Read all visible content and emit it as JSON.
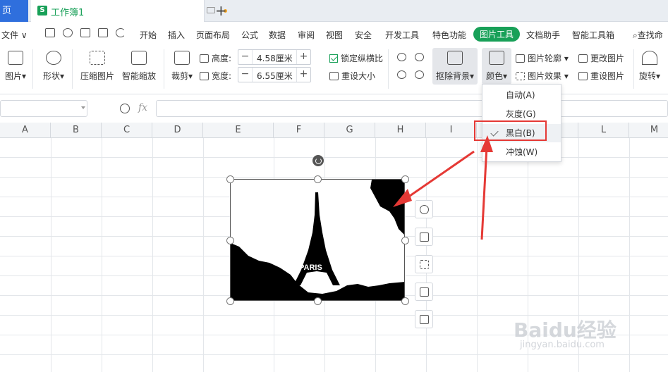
{
  "tabs": {
    "home": "页",
    "doc_title": "工作簿1",
    "doc_icon": "S"
  },
  "menu": {
    "file": "文件",
    "items": [
      "开始",
      "插入",
      "页面布局",
      "公式",
      "数据",
      "审阅",
      "视图",
      "安全",
      "开发工具",
      "特色功能",
      "图片工具",
      "文档助手",
      "智能工具箱"
    ],
    "active": "图片工具",
    "search": "查找命"
  },
  "ribbon": {
    "add_picture": "图片",
    "shape": "形状",
    "compress": "压缩图片",
    "smart_zoom": "智能缩放",
    "crop": "裁剪",
    "height_label": "高度:",
    "height_value": "4.58厘米",
    "width_label": "宽度:",
    "width_value": "6.55厘米",
    "lock_ratio": "锁定纵横比",
    "reset_size": "重设大小",
    "remove_bg": "抠除背景",
    "color": "颜色",
    "outline": "图片轮廓",
    "effect": "图片效果",
    "change": "更改图片",
    "reset_pic": "重设图片",
    "rotate": "旋转"
  },
  "formula": {
    "fx": "fx"
  },
  "columns": [
    "A",
    "B",
    "C",
    "D",
    "E",
    "F",
    "G",
    "H",
    "I",
    "J",
    "K",
    "L",
    "M"
  ],
  "color_menu": {
    "items": [
      {
        "label": "自动(A)"
      },
      {
        "label": "灰度(G)"
      },
      {
        "label": "黑白(B)"
      },
      {
        "label": "冲蚀(W)"
      }
    ],
    "selected": "黑白(B)"
  },
  "picture": {
    "caption": "PARIS"
  },
  "watermark": {
    "main": "Baidu经验",
    "sub": "jingyan.baidu.com"
  },
  "colors": {
    "accent": "#18a058",
    "tab_active": "#2f6fdd",
    "annotation": "#e53935"
  }
}
